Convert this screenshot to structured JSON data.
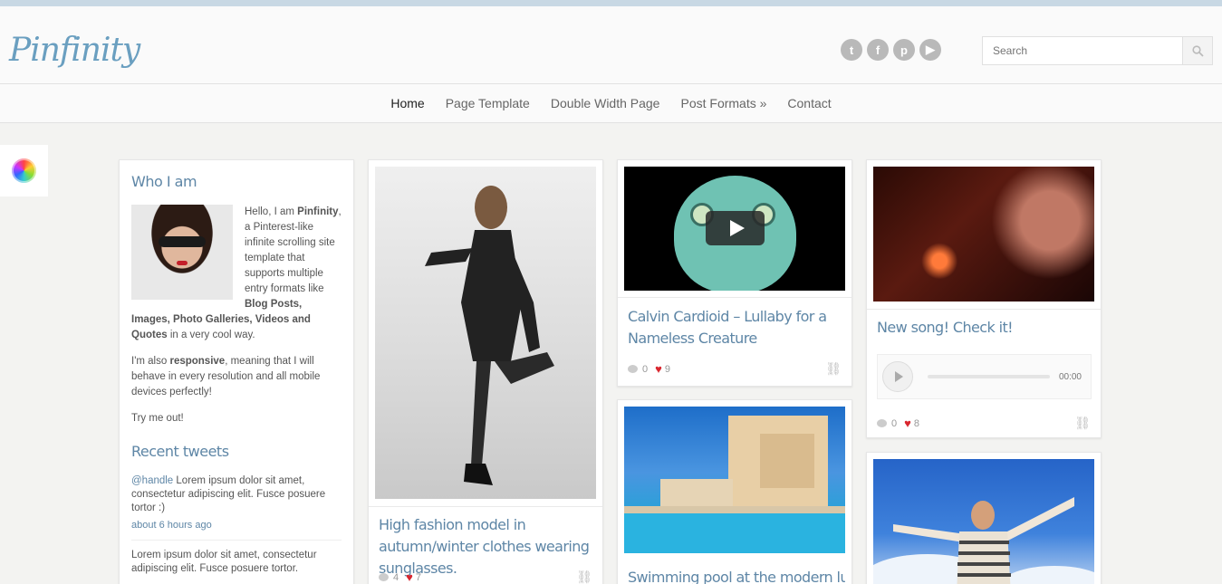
{
  "header": {
    "logo": "Pinfinity",
    "social": [
      {
        "icon": "twitter-icon",
        "glyph": "t"
      },
      {
        "icon": "facebook-icon",
        "glyph": "f"
      },
      {
        "icon": "pinterest-icon",
        "glyph": "p"
      },
      {
        "icon": "youtube-icon",
        "glyph": "▶"
      }
    ],
    "search": {
      "placeholder": "Search"
    }
  },
  "nav": {
    "items": [
      "Home",
      "Page Template",
      "Double Width Page",
      "Post Formats »",
      "Contact"
    ],
    "active": "Home"
  },
  "sidebar": {
    "who_title": "Who I am",
    "about_intro_1": "Hello, I am ",
    "about_name": "Pinfinity",
    "about_intro_2": ", a Pinterest-like infinite scrolling site template that supports multiple entry formats like ",
    "about_formats_1": "Blog Posts, Images, Photo Galleries, Videos and Quotes",
    "about_intro_3": " in a very cool way.",
    "about_p2_1": "I'm also ",
    "about_p2_bold": "responsive",
    "about_p2_2": ", meaning that I will behave in every resolution and all mobile devices perfectly!",
    "about_p3": "Try me out!",
    "tweets_title": "Recent tweets",
    "tweets": [
      {
        "handle": "@handle",
        "text": " Lorem ipsum dolor sit amet, consectetur adipiscing elit. Fusce posuere tortor :)",
        "time": "about 6 hours ago"
      },
      {
        "handle": "",
        "text": "Lorem ipsum dolor sit amet, consectetur adipiscing elit. Fusce posuere tortor.",
        "time": ""
      }
    ]
  },
  "posts": [
    {
      "title": "High fashion model in autumn/winter clothes wearing sunglasses.",
      "comments": "4",
      "likes": "7"
    },
    {
      "title": "Calvin Cardioid – Lullaby for a Nameless Creature",
      "comments": "0",
      "likes": "9"
    },
    {
      "title": "Swimming pool at the modern luxury",
      "comments": "",
      "likes": ""
    },
    {
      "title": "New song! Check it!",
      "comments": "0",
      "likes": "8",
      "audio_time": "00:00"
    },
    {
      "title": "",
      "comments": "",
      "likes": ""
    }
  ],
  "colors": {
    "accent": "#5e86a6",
    "heart": "#d9262e",
    "topbar": "#c8d8e4"
  }
}
